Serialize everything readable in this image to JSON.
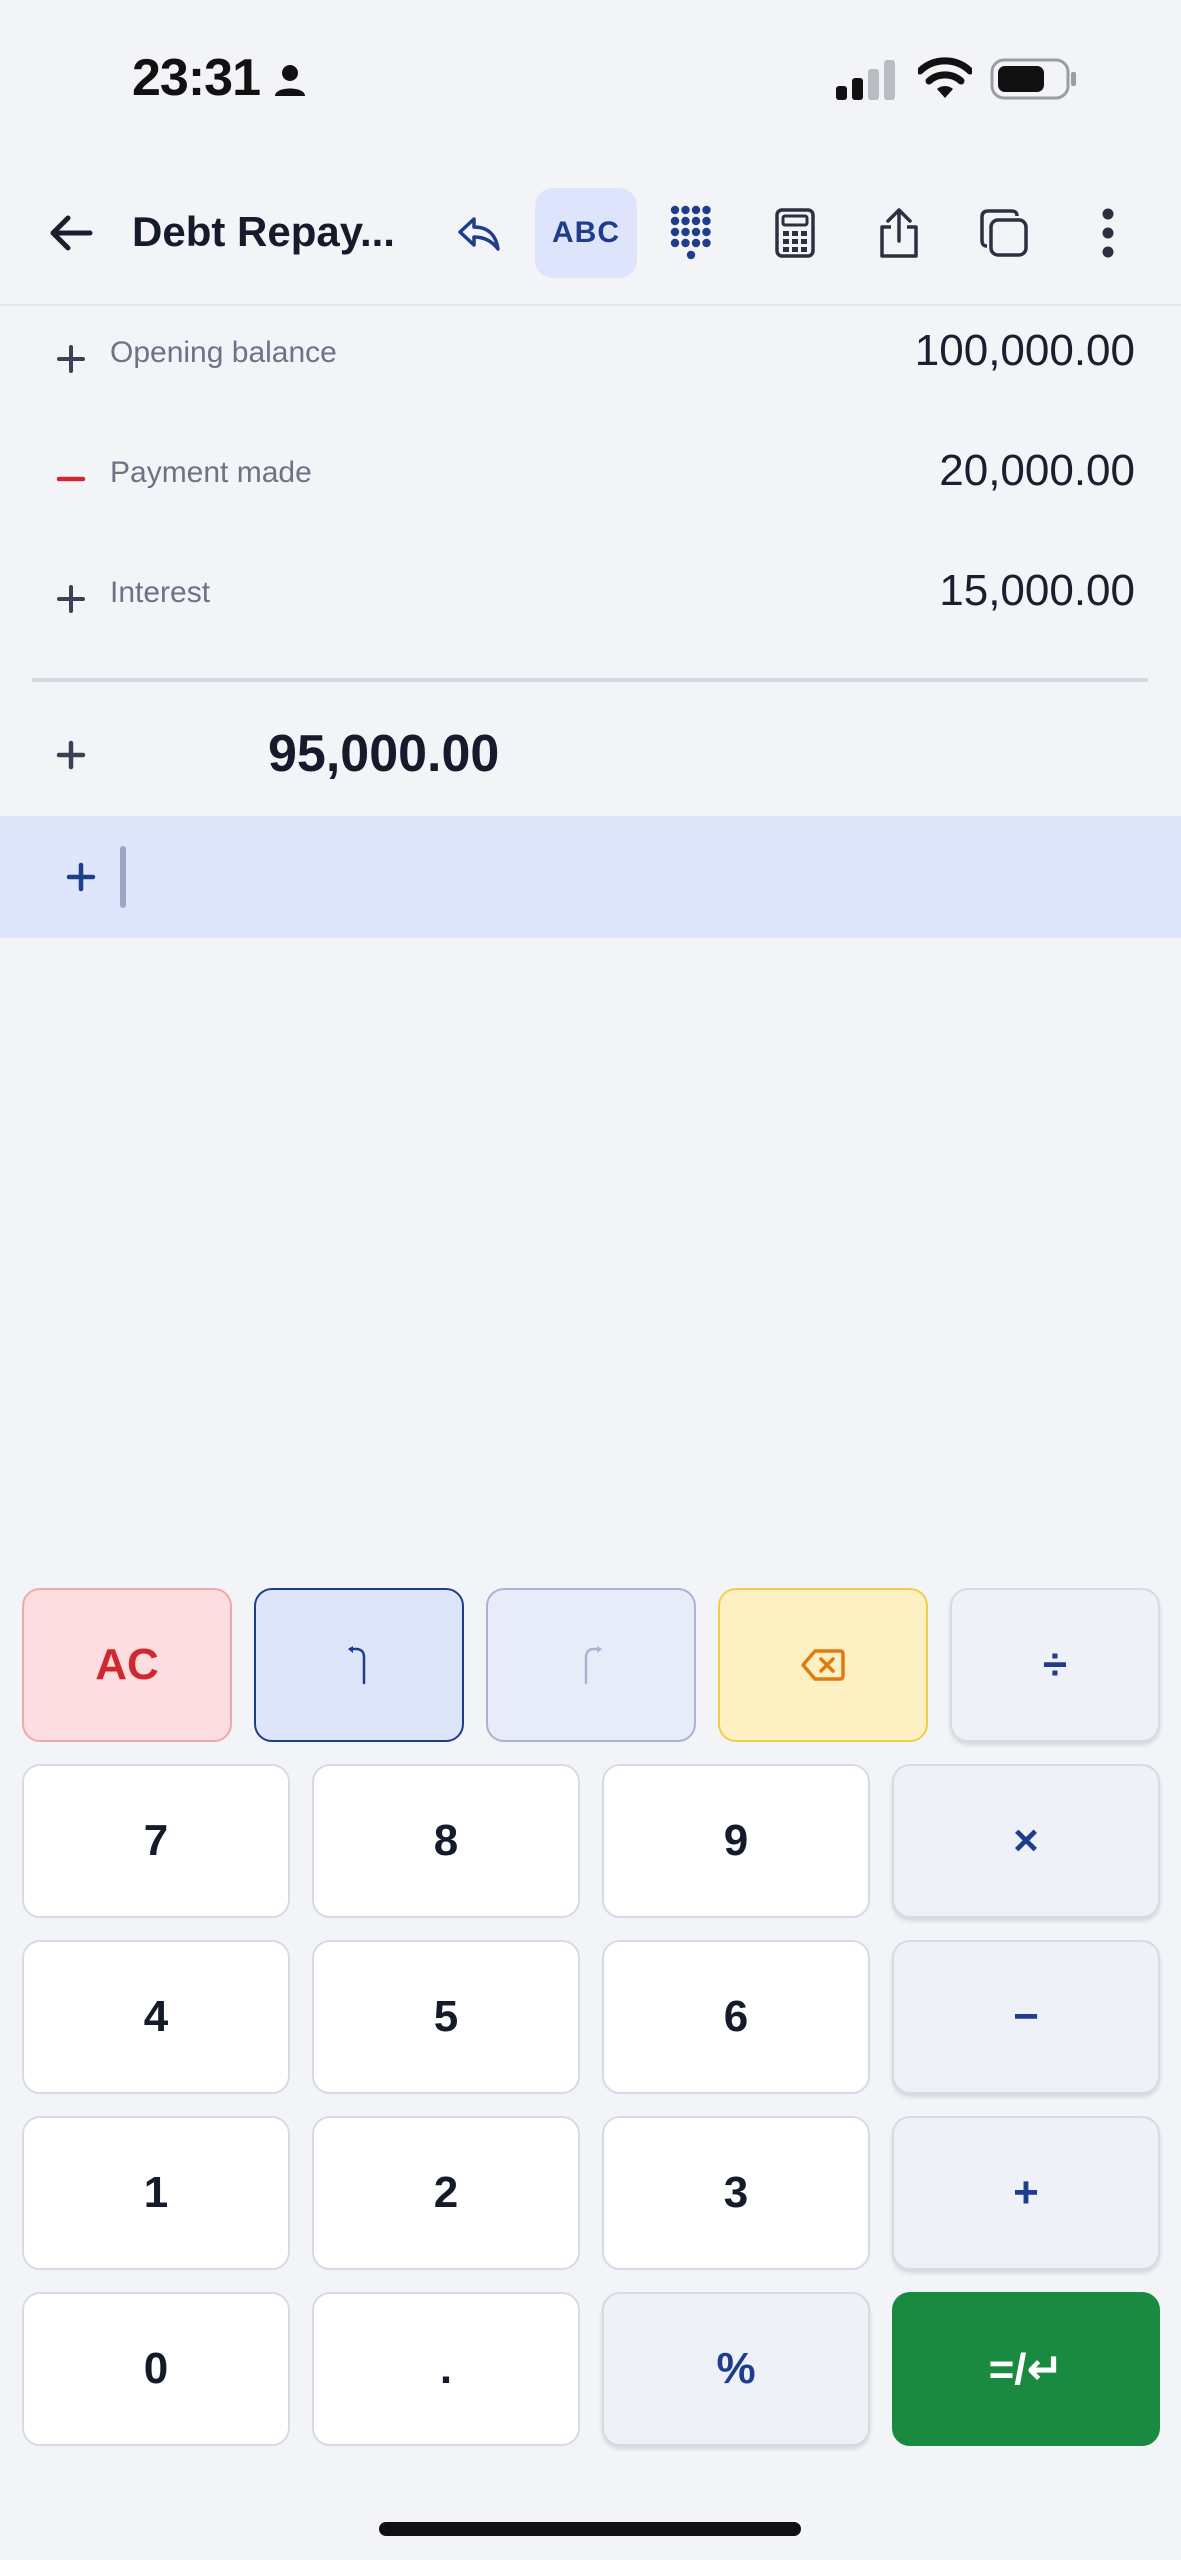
{
  "status_bar": {
    "time": "23:31",
    "icons": [
      "person-icon",
      "signal-icon",
      "wifi-icon",
      "battery-icon"
    ]
  },
  "toolbar": {
    "back_icon": "arrow-left-icon",
    "title": "Debt Repay...",
    "undo_icon": "reply-icon",
    "abc_label": "ABC",
    "keypad_icon": "keypad-icon",
    "calculator_icon": "calculator-icon",
    "share_icon": "share-icon",
    "copy_icon": "copy-icon",
    "more_icon": "more-vertical-icon"
  },
  "entries": [
    {
      "sign": "+",
      "label": "Opening balance",
      "amount": "100,000.00"
    },
    {
      "sign": "−",
      "label": "Payment made",
      "amount": "20,000.00"
    },
    {
      "sign": "+",
      "label": "Interest",
      "amount": "15,000.00"
    }
  ],
  "total": {
    "sign": "+",
    "value": "95,000.00"
  },
  "input": {
    "sign": "+",
    "value": ""
  },
  "keypad": {
    "ac": "AC",
    "divide": "÷",
    "multiply": "×",
    "minus": "−",
    "plus": "+",
    "percent": "%",
    "dot": ".",
    "equals": "=/↵",
    "digits": [
      "7",
      "8",
      "9",
      "4",
      "5",
      "6",
      "1",
      "2",
      "3",
      "0"
    ]
  },
  "colors": {
    "accent": "#1f3d8a",
    "minus_sign": "#d1282f",
    "equals_bg": "#198a3f",
    "ac_bg": "#fddde0",
    "backspace_bg": "#fdf1c4",
    "input_row_bg": "#dfe5fb"
  }
}
